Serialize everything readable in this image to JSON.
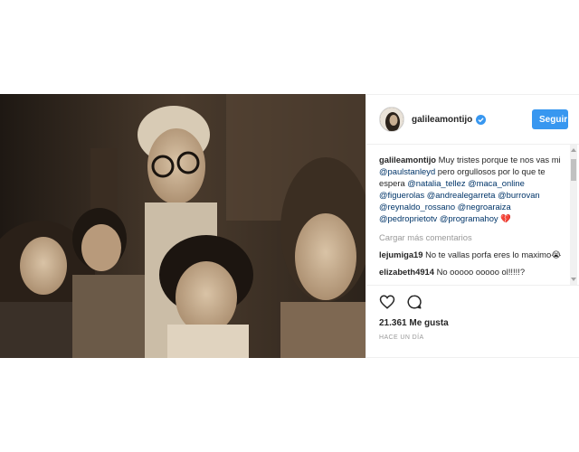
{
  "post": {
    "username": "galileamontijo",
    "follow_label": "Seguir",
    "verified_icon": "verified-badge-icon",
    "accent_color": "#3897f0"
  },
  "caption": {
    "username": "galileamontijo",
    "text_1": " Muy tristes porque te nos vas mi ",
    "mention_1": "@paulstanleyd",
    "text_2": " pero orgullosos por lo que te espera ",
    "mention_2": "@natalia_tellez",
    "mention_3": "@maca_online",
    "mention_4": "@figuerolas",
    "mention_5": "@andrealegarreta",
    "mention_6": "@burrovan",
    "mention_7": "@reynaldo_rossano",
    "mention_8": "@negroaraiza",
    "mention_9": "@pedroprietotv",
    "mention_10": "@programahoy",
    "emoji": "💔"
  },
  "load_more": "Cargar más comentarios",
  "comments": [
    {
      "username": "lejumiga19",
      "text": " No te vallas porfa eres lo maximo😭"
    },
    {
      "username": "elizabeth4914",
      "text": " No ooooo ooooo ol!!!!!? "
    }
  ],
  "likes": "21.361 Me gusta",
  "time": "HACE UN DÍA",
  "icons": [
    "heart-icon",
    "comment-icon"
  ]
}
